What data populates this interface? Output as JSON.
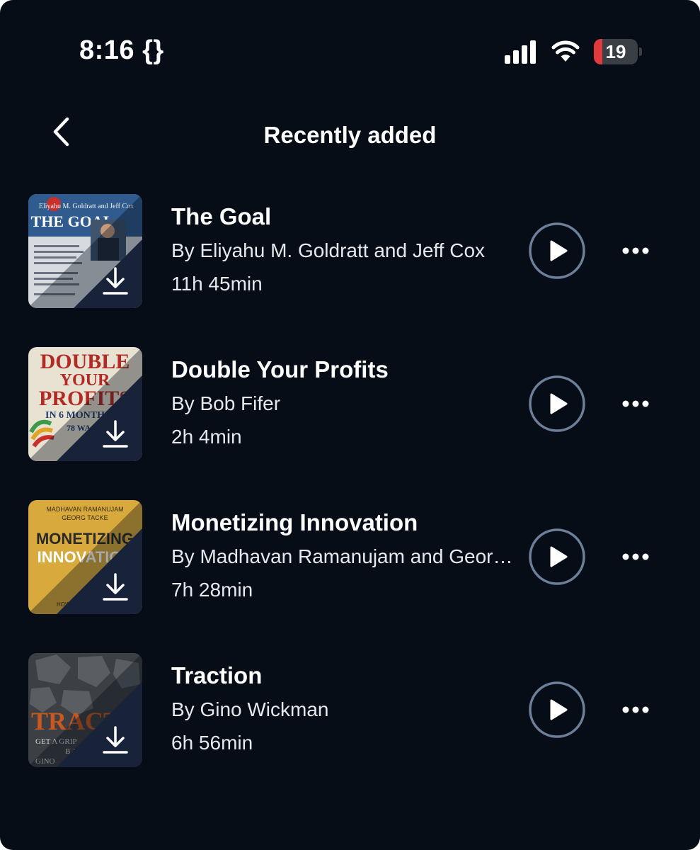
{
  "status_bar": {
    "time": "8:16 {}",
    "battery": "19",
    "battery_level": 0.19,
    "battery_color": "#e0393e",
    "signal_icon": "cellular-signal-icon",
    "wifi_icon": "wifi-icon"
  },
  "header": {
    "title": "Recently added",
    "back_icon": "chevron-left-icon"
  },
  "colors": {
    "background": "#060d17",
    "play_ring": "#6d7f99",
    "overlay": "#18233a"
  },
  "books": [
    {
      "title": "The Goal",
      "author": "By Eliyahu M. Goldratt and Jeff Cox",
      "duration": "11h 45min",
      "cover": {
        "author_line": "Eliyahu M. Goldratt and Jeff Cox",
        "title_line": "THE GOAL"
      }
    },
    {
      "title": "Double Your Profits",
      "author": "By Bob Fifer",
      "duration": "2h 4min",
      "cover": {
        "line1": "DOUBLE",
        "line2": "YOUR",
        "line3": "PROFITS",
        "line4": "IN 6 MONTHS OR",
        "line5": "78 WA"
      }
    },
    {
      "title": "Monetizing Innovation",
      "author": "By Madhavan Ramanujam and Georg Tacke",
      "duration": "7h 28min",
      "cover": {
        "author1": "MADHAVAN RAMANUJAM",
        "author2": "GEORG TACKE",
        "title1": "MONETIZING",
        "title2": "INNOVATION",
        "footer": "HOW SMART"
      }
    },
    {
      "title": "Traction",
      "author": "By Gino Wickman",
      "duration": "6h 56min",
      "cover": {
        "title": "TRACTION",
        "sub1": "GET A GRIP",
        "sub2": "BUS",
        "sub3": "GINO"
      }
    }
  ]
}
